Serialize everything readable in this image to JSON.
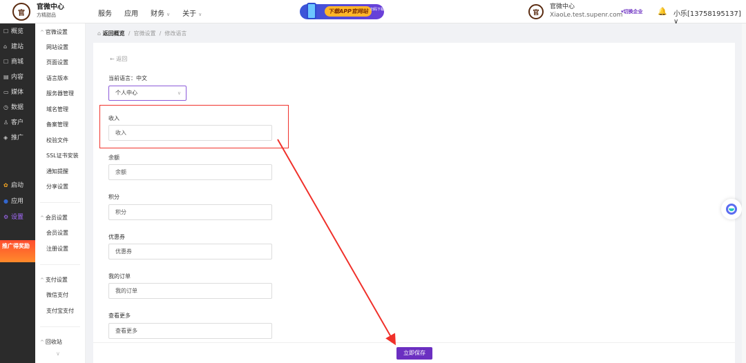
{
  "header": {
    "brand_logo_text": "官",
    "brand_title": "官微中心",
    "brand_subtitle": "方精甜品",
    "nav": [
      {
        "label": "服务",
        "caret": ""
      },
      {
        "label": "应用",
        "caret": ""
      },
      {
        "label": "财务",
        "caret": "∨"
      },
      {
        "label": "关于",
        "caret": "∨"
      }
    ],
    "promo_label": "下载APP官网站",
    "promo_small": "扫码下载",
    "org_logo_text": "官",
    "org_name": "官微中心",
    "org_domain": "XiaoLe.test.supenr.com",
    "switch_label": "▾切换企业",
    "bell_icon": "🔔",
    "user_label": "小乐[13758195137]  ∨"
  },
  "rail": {
    "items": [
      {
        "icon": "☐",
        "label": "概览"
      },
      {
        "icon": "⌂",
        "label": "建站"
      },
      {
        "icon": "☐",
        "label": "商城"
      },
      {
        "icon": "▤",
        "label": "内容"
      },
      {
        "icon": "▭",
        "label": "媒体"
      },
      {
        "icon": "◷",
        "label": "数据"
      },
      {
        "icon": "♙",
        "label": "客户"
      },
      {
        "icon": "◈",
        "label": "推广"
      }
    ],
    "items2": [
      {
        "icon": "✿",
        "label": "启动"
      },
      {
        "icon": "●",
        "label": "应用"
      },
      {
        "icon": "⚙",
        "label": "设置"
      }
    ],
    "ad_text": "推广得奖励"
  },
  "side2": {
    "group1": "官微设置",
    "group1_items": [
      "网站设置",
      "页面设置",
      "语言版本",
      "服务器管理",
      "域名管理",
      "备案管理",
      "校验文件",
      "SSL证书安装",
      "通知提醒",
      "分享设置"
    ],
    "group2": "会员设置",
    "group2_items": [
      "会员设置",
      "注册设置"
    ],
    "group3": "支付设置",
    "group3_items": [
      "微信支付",
      "支付宝支付"
    ],
    "group4": "回收站",
    "caret": "^",
    "more": "∨"
  },
  "breadcrumb": {
    "home_icon": "⌂",
    "home": "返回概览",
    "sep": "/",
    "level1": "官微设置",
    "level2": "修改语言"
  },
  "main": {
    "back_label": "← 返回",
    "current_language_label": "当前语言：中文",
    "select_value": "个人中心",
    "select_chevron": "∨",
    "fields": [
      {
        "label": "收入",
        "value": "收入"
      },
      {
        "label": "余额",
        "value": "余额"
      },
      {
        "label": "积分",
        "value": "积分"
      },
      {
        "label": "优惠券",
        "value": "优惠券"
      },
      {
        "label": "我的订单",
        "value": "我的订单"
      },
      {
        "label": "查看更多",
        "value": "查看更多"
      }
    ],
    "save_button": "立即保存"
  },
  "colors": {
    "accent": "#6b2fc1",
    "annotation_red": "#f0302a",
    "rail_bg": "#2b2b2b"
  }
}
